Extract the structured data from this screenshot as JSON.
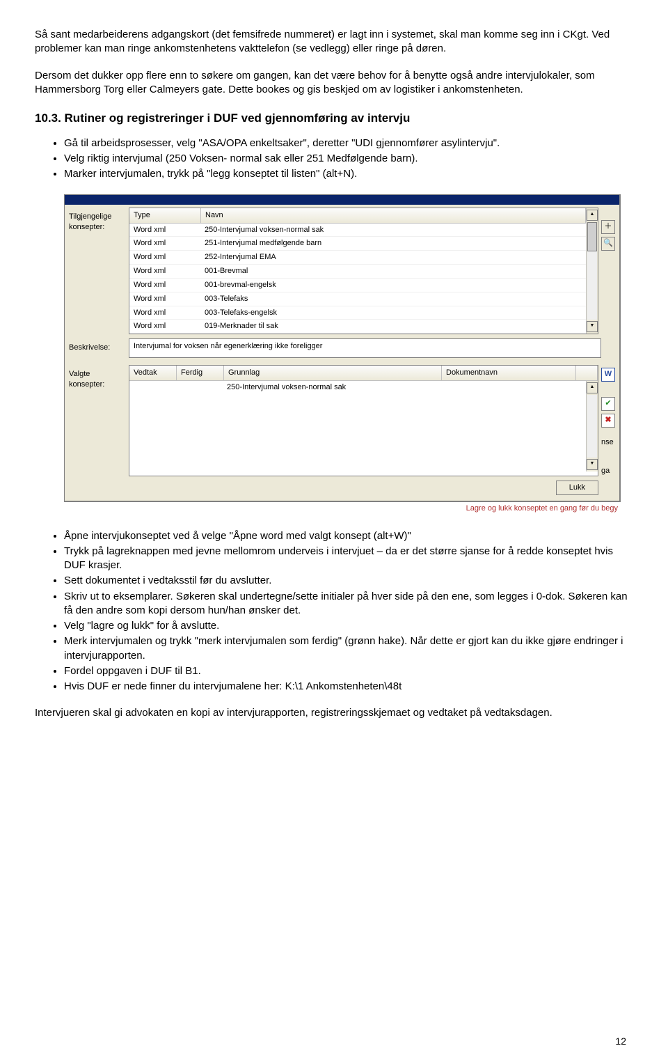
{
  "para1": "Så sant medarbeiderens adgangskort (det femsifrede nummeret) er lagt inn i systemet, skal man komme seg inn i CKgt. Ved problemer kan man ringe ankomstenhetens vakttelefon (se vedlegg) eller ringe på døren.",
  "para2": "Dersom det dukker opp flere enn to søkere om gangen, kan det være behov for å benytte også andre intervjulokaler, som Hammersborg Torg eller Calmeyers gate. Dette bookes og gis beskjed om av logistiker i ankomstenheten.",
  "heading": "10.3. Rutiner og registreringer i DUF ved gjennomføring av intervju",
  "bullets1": [
    "Gå til arbeidsprosesser, velg \"ASA/OPA enkeltsaker\", deretter \"UDI gjennomfører asylintervju\".",
    "Velg riktig intervjumal (250 Voksen- normal sak eller 251 Medfølgende barn).",
    "Marker intervjumalen, trykk på \"legg konseptet til listen\" (alt+N)."
  ],
  "screenshot": {
    "labels": {
      "tilgjengelige": "Tilgjengelige konsepter:",
      "beskrivelse": "Beskrivelse:",
      "valgte": "Valgte konsepter:"
    },
    "topTable": {
      "headers": {
        "type": "Type",
        "navn": "Navn"
      },
      "rows": [
        {
          "type": "Word xml",
          "name": "250-Intervjumal voksen-normal sak"
        },
        {
          "type": "Word xml",
          "name": "251-Intervjumal medfølgende barn"
        },
        {
          "type": "Word xml",
          "name": "252-Intervjumal EMA"
        },
        {
          "type": "Word xml",
          "name": "001-Brevmal"
        },
        {
          "type": "Word xml",
          "name": "001-brevmal-engelsk"
        },
        {
          "type": "Word xml",
          "name": "003-Telefaks"
        },
        {
          "type": "Word xml",
          "name": "003-Telefaks-engelsk"
        },
        {
          "type": "Word xml",
          "name": "019-Merknader til sak"
        }
      ]
    },
    "description": "Intervjumal for voksen når egenerklæring ikke foreligger",
    "bottomTable": {
      "headers": {
        "vedtak": "Vedtak",
        "ferdig": "Ferdig",
        "grunnlag": "Grunnlag",
        "dokumentnavn": "Dokumentnavn"
      },
      "rowName": "250-Intervjumal voksen-normal sak"
    },
    "lukk": "Lukk",
    "footer": "Lagre og lukk konseptet en gang før du begy",
    "sideTexts": {
      "nse": "nse",
      "ga": "ga"
    }
  },
  "bullets2": [
    "Åpne intervjukonseptet ved å velge \"Åpne word med valgt konsept (alt+W)\"",
    "Trykk på lagreknappen med jevne mellomrom underveis i intervjuet – da er det større sjanse for å redde konseptet hvis DUF krasjer.",
    "Sett dokumentet i vedtaksstil før du avslutter.",
    "Skriv ut to eksemplarer. Søkeren skal undertegne/sette initialer på hver side på den ene, som legges i 0-dok. Søkeren kan få den andre som kopi dersom hun/han ønsker det.",
    "Velg \"lagre og lukk\" for å avslutte.",
    "Merk intervjumalen og trykk \"merk intervjumalen som ferdig\" (grønn hake). Når dette er gjort kan du ikke gjøre endringer i intervjurapporten.",
    "Fordel oppgaven i DUF til B1.",
    "Hvis DUF er nede finner du intervjumalene her: K:\\1 Ankomstenheten\\48t"
  ],
  "para3": "Intervjueren skal gi advokaten en kopi av intervjurapporten, registreringsskjemaet og vedtaket på vedtaksdagen.",
  "pageNumber": "12"
}
